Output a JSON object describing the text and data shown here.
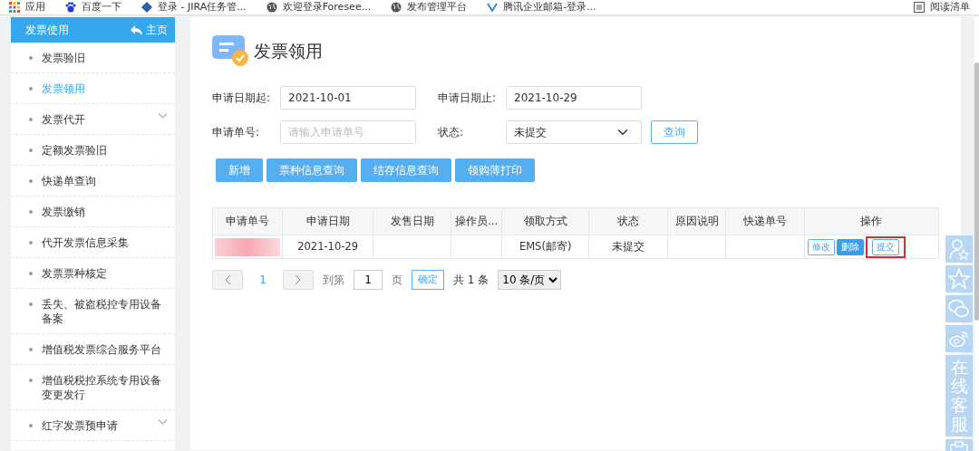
{
  "bookmarks": [
    {
      "label": "应用",
      "kind": "apps"
    },
    {
      "label": "百度一下",
      "kind": "paw"
    },
    {
      "label": "登录 - JIRA任务管...",
      "kind": "diamond"
    },
    {
      "label": "欢迎登录Foresee...",
      "kind": "globe"
    },
    {
      "label": "发布管理平台",
      "kind": "globe"
    },
    {
      "label": "腾讯企业邮箱-登录...",
      "kind": "mail"
    }
  ],
  "reading_list": {
    "label": "阅读清单"
  },
  "sidebar": {
    "title": "发票使用",
    "home": "主页",
    "items": [
      {
        "label": "发票验旧",
        "selected": false,
        "expandable": false
      },
      {
        "label": "发票领用",
        "selected": true,
        "expandable": false
      },
      {
        "label": "发票代开",
        "selected": false,
        "expandable": true
      },
      {
        "label": "定额发票验旧",
        "selected": false,
        "expandable": false
      },
      {
        "label": "快递单查询",
        "selected": false,
        "expandable": false
      },
      {
        "label": "发票缴销",
        "selected": false,
        "expandable": false
      },
      {
        "label": "代开发票信息采集",
        "selected": false,
        "expandable": false
      },
      {
        "label": "发票票种核定",
        "selected": false,
        "expandable": false
      },
      {
        "label": "丢失、被盗税控专用设备备案",
        "selected": false,
        "expandable": false
      },
      {
        "label": "增值税发票综合服务平台",
        "selected": false,
        "expandable": false
      },
      {
        "label": "增值税税控系统专用设备变更发行",
        "selected": false,
        "expandable": false
      },
      {
        "label": "红字发票预申请",
        "selected": false,
        "expandable": true
      }
    ]
  },
  "page_title": "发票领用",
  "form": {
    "fields": [
      {
        "label": "申请日期起:",
        "kind": "text",
        "value": "2021-10-01"
      },
      {
        "label": "申请日期止:",
        "kind": "text",
        "value": "2021-10-29"
      },
      {
        "label": "申请单号:",
        "kind": "text",
        "placeholder": "请输入申请单号"
      },
      {
        "label": "状态:",
        "kind": "select",
        "value": "未提交"
      }
    ],
    "query_button": "查询"
  },
  "action_buttons": [
    "新增",
    "票种信息查询",
    "结存信息查询",
    "领购薄打印"
  ],
  "table": {
    "columns": [
      "申请单号",
      "申请日期",
      "发售日期",
      "操作员...",
      "领取方式",
      "状态",
      "原因说明",
      "快递单号",
      "操作"
    ],
    "rows": [
      {
        "cells": [
          null,
          "2021-10-29",
          "",
          "",
          "EMS(邮寄)",
          "未提交",
          "",
          ""
        ],
        "redacted": true,
        "actions": [
          {
            "label": "修改",
            "kind": "outline",
            "highlighted": false
          },
          {
            "label": "删除",
            "kind": "solid",
            "highlighted": false
          },
          {
            "label": "提交",
            "kind": "outline",
            "highlighted": true
          }
        ]
      }
    ]
  },
  "pagination": {
    "pages": [
      {
        "label": "1",
        "selected": true
      }
    ],
    "goto_label": "到第",
    "goto_value": "1",
    "page_unit": "页",
    "confirm": "确定",
    "total": "共 1 条",
    "page_size": "10 条/页"
  },
  "side_panel": {
    "service": "在线客服"
  }
}
